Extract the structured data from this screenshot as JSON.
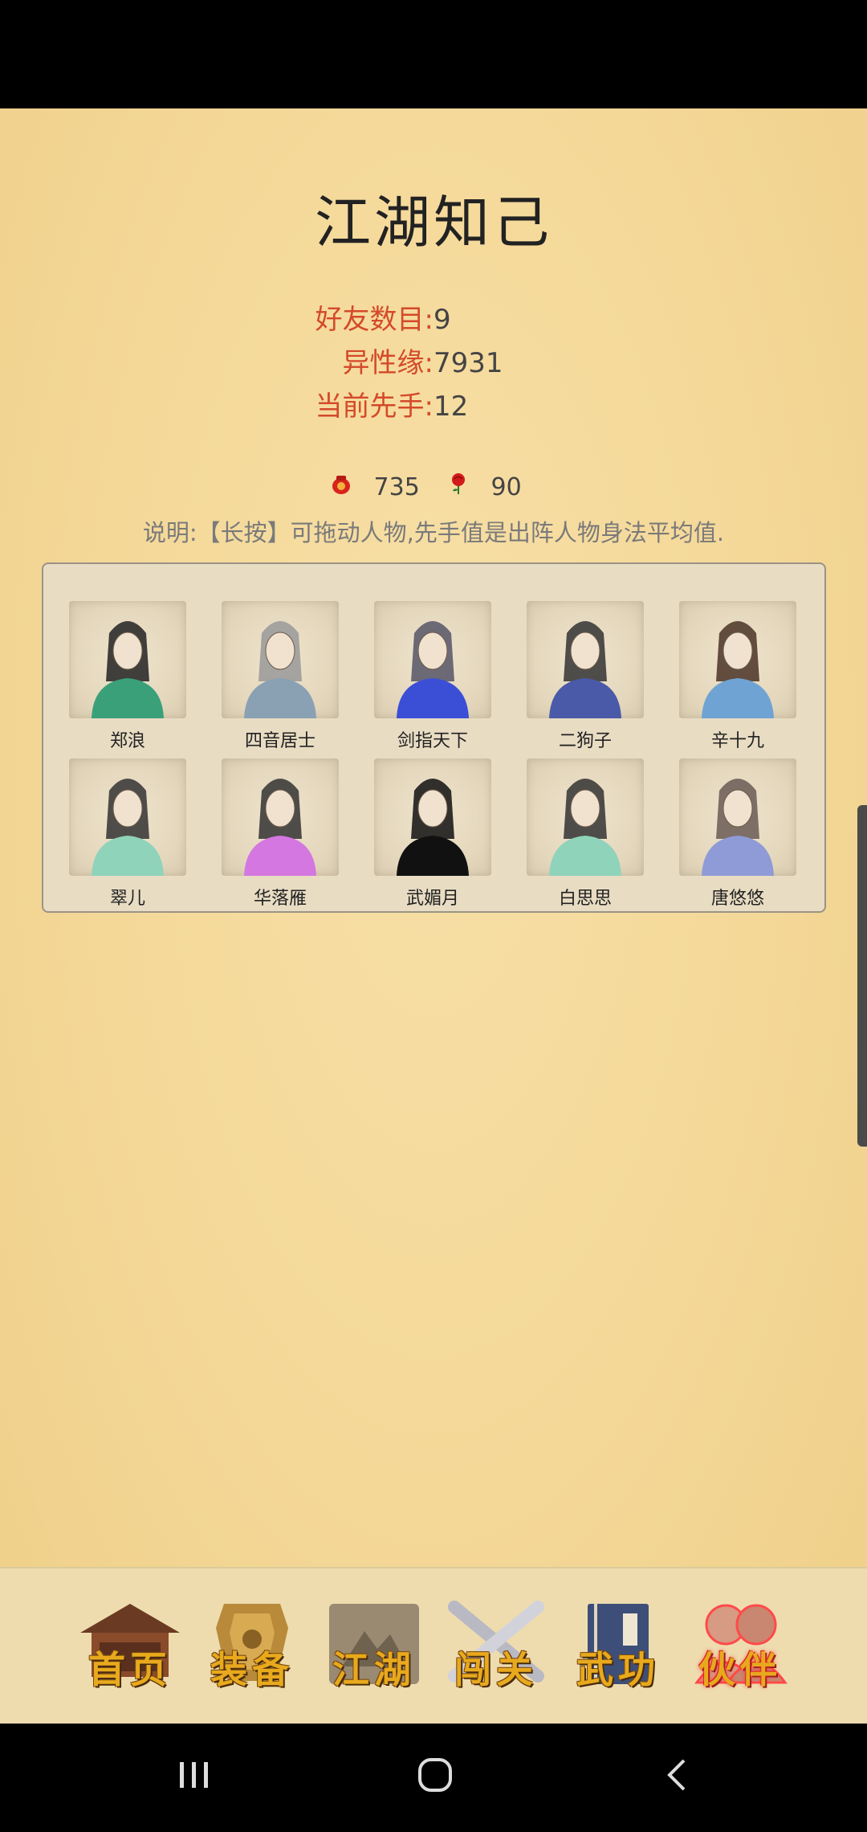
{
  "page": {
    "title": "江湖知己"
  },
  "stats": {
    "friends_label": "好友数目:",
    "friends_value": "9",
    "affinity_label": "异性缘:",
    "affinity_value": "7931",
    "initiative_label": "当前先手:",
    "initiative_value": "12"
  },
  "currency": {
    "pouch_icon": "red-pouch-icon",
    "pouch_value": "735",
    "rose_icon": "red-rose-icon",
    "rose_value": "90"
  },
  "hint": "说明:【长按】可拖动人物,先手值是出阵人物身法平均值.",
  "characters": [
    {
      "name": "郑浪",
      "robe": "#3aa07a",
      "hair": "#222"
    },
    {
      "name": "四音居士",
      "robe": "#8aa0b3",
      "hair": "#999"
    },
    {
      "name": "剑指天下",
      "robe": "#3b4fd6",
      "hair": "#556"
    },
    {
      "name": "二狗子",
      "robe": "#4a5aa8",
      "hair": "#333"
    },
    {
      "name": "辛十九",
      "robe": "#6fa3d3",
      "hair": "#4a3326"
    },
    {
      "name": "翠儿",
      "robe": "#8fd3bb",
      "hair": "#333"
    },
    {
      "name": "华落雁",
      "robe": "#d477e0",
      "hair": "#333"
    },
    {
      "name": "武媚月",
      "robe": "#111",
      "hair": "#111"
    },
    {
      "name": "白思思",
      "robe": "#8fd3bb",
      "hair": "#333"
    },
    {
      "name": "唐悠悠",
      "robe": "#8e9bd6",
      "hair": "#6a5a55"
    }
  ],
  "nav": {
    "home": "首页",
    "equip": "装备",
    "jianghu": "江湖",
    "challenge": "闯关",
    "martial": "武功",
    "partner": "伙伴"
  },
  "colors": {
    "accent_label": "#d34a2a",
    "nav_label": "#e8a91d"
  }
}
